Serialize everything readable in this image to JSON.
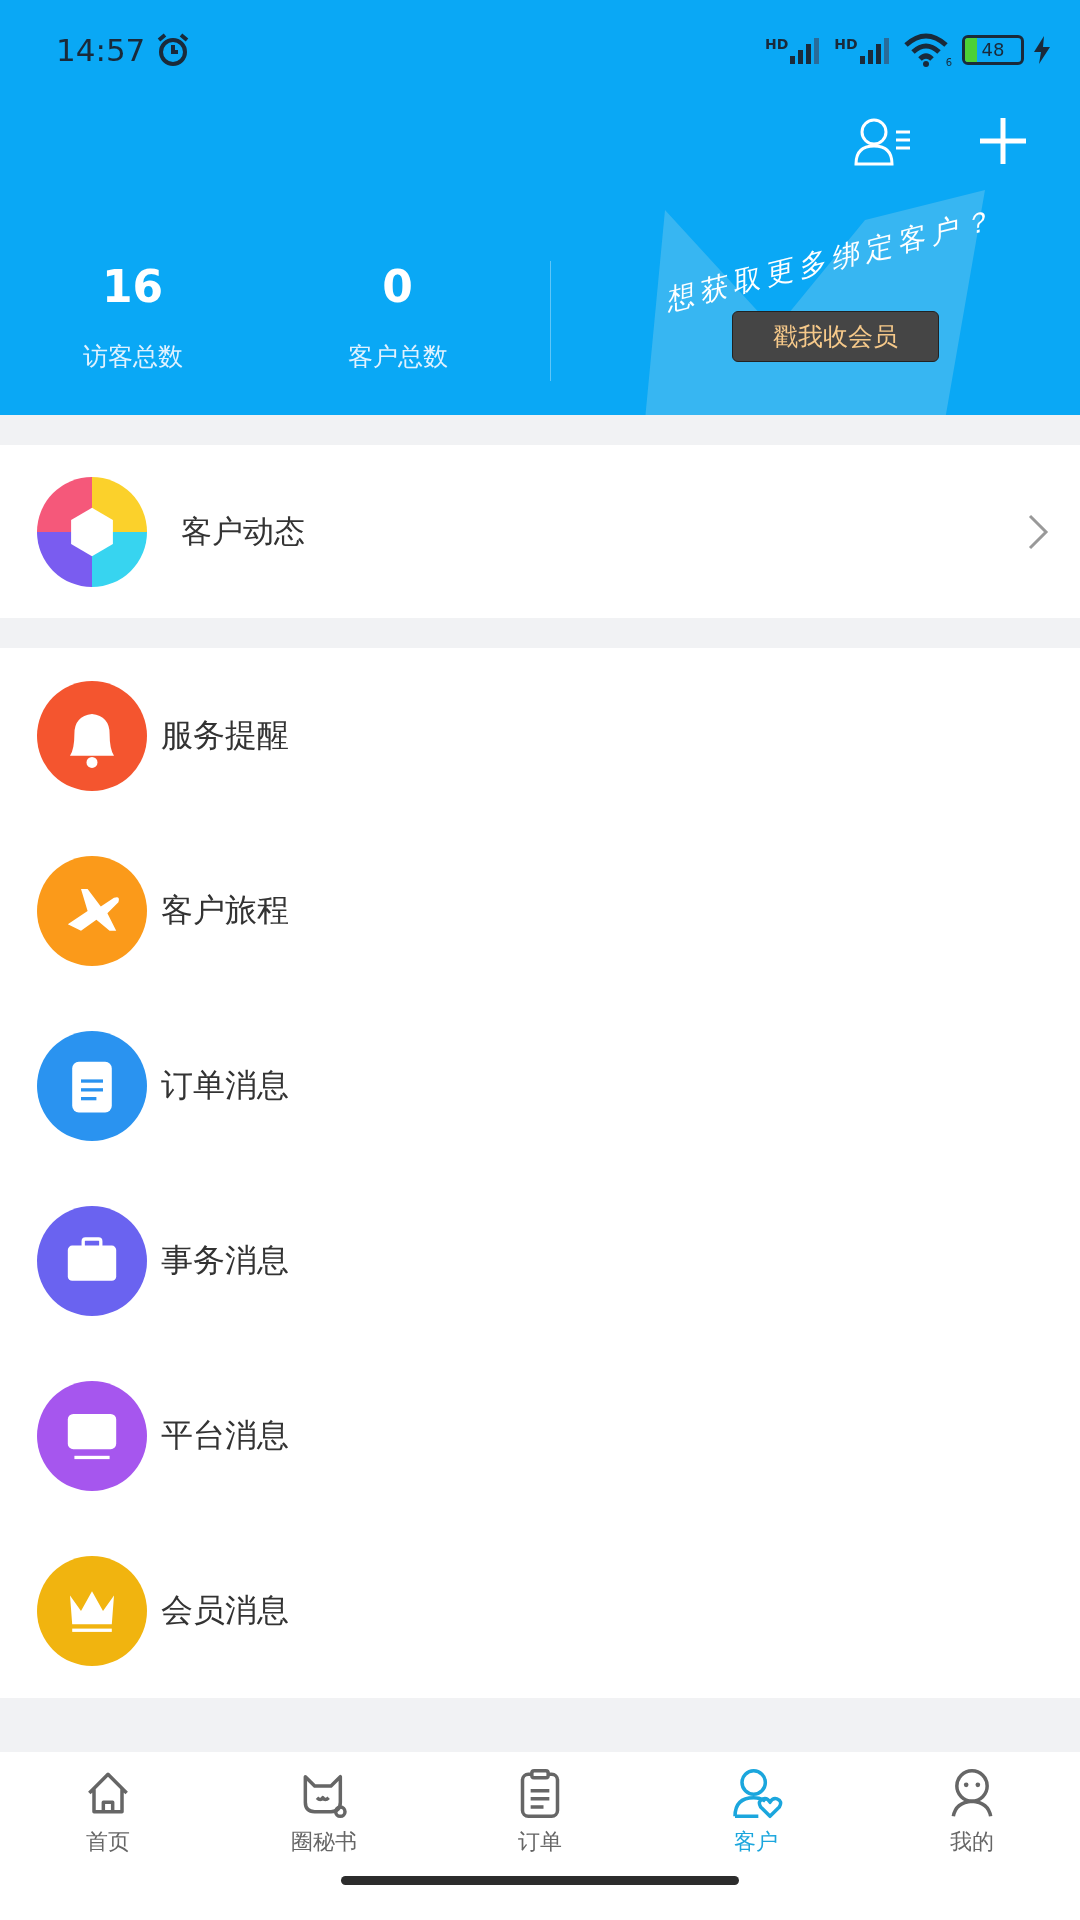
{
  "status_bar": {
    "time": "14:57",
    "signal_labels": [
      "HD",
      "HD"
    ],
    "wifi_label": "6",
    "battery": "48"
  },
  "header": {
    "stats": [
      {
        "value": "16",
        "label": "访客总数"
      },
      {
        "value": "0",
        "label": "客户总数"
      }
    ],
    "promo": {
      "slogan": "想获取更多绑定客户？",
      "button": "戳我收会员"
    }
  },
  "feed": {
    "label": "客户动态"
  },
  "messages": [
    {
      "label": "服务提醒",
      "kind": "bell",
      "color": "#f4552f"
    },
    {
      "label": "客户旅程",
      "kind": "plane",
      "color": "#fb9a1a"
    },
    {
      "label": "订单消息",
      "kind": "clipboard",
      "color": "#2a93f0"
    },
    {
      "label": "事务消息",
      "kind": "briefcase",
      "color": "#6a63f0"
    },
    {
      "label": "平台消息",
      "kind": "monitor",
      "color": "#a656ee"
    },
    {
      "label": "会员消息",
      "kind": "crown",
      "color": "#f1b40f"
    }
  ],
  "tabs": [
    {
      "label": "首页",
      "kind": "home",
      "selected": false
    },
    {
      "label": "圈秘书",
      "kind": "cat",
      "selected": false
    },
    {
      "label": "订单",
      "kind": "order",
      "selected": false
    },
    {
      "label": "客户",
      "kind": "customer",
      "selected": true
    },
    {
      "label": "我的",
      "kind": "me",
      "selected": false
    }
  ]
}
